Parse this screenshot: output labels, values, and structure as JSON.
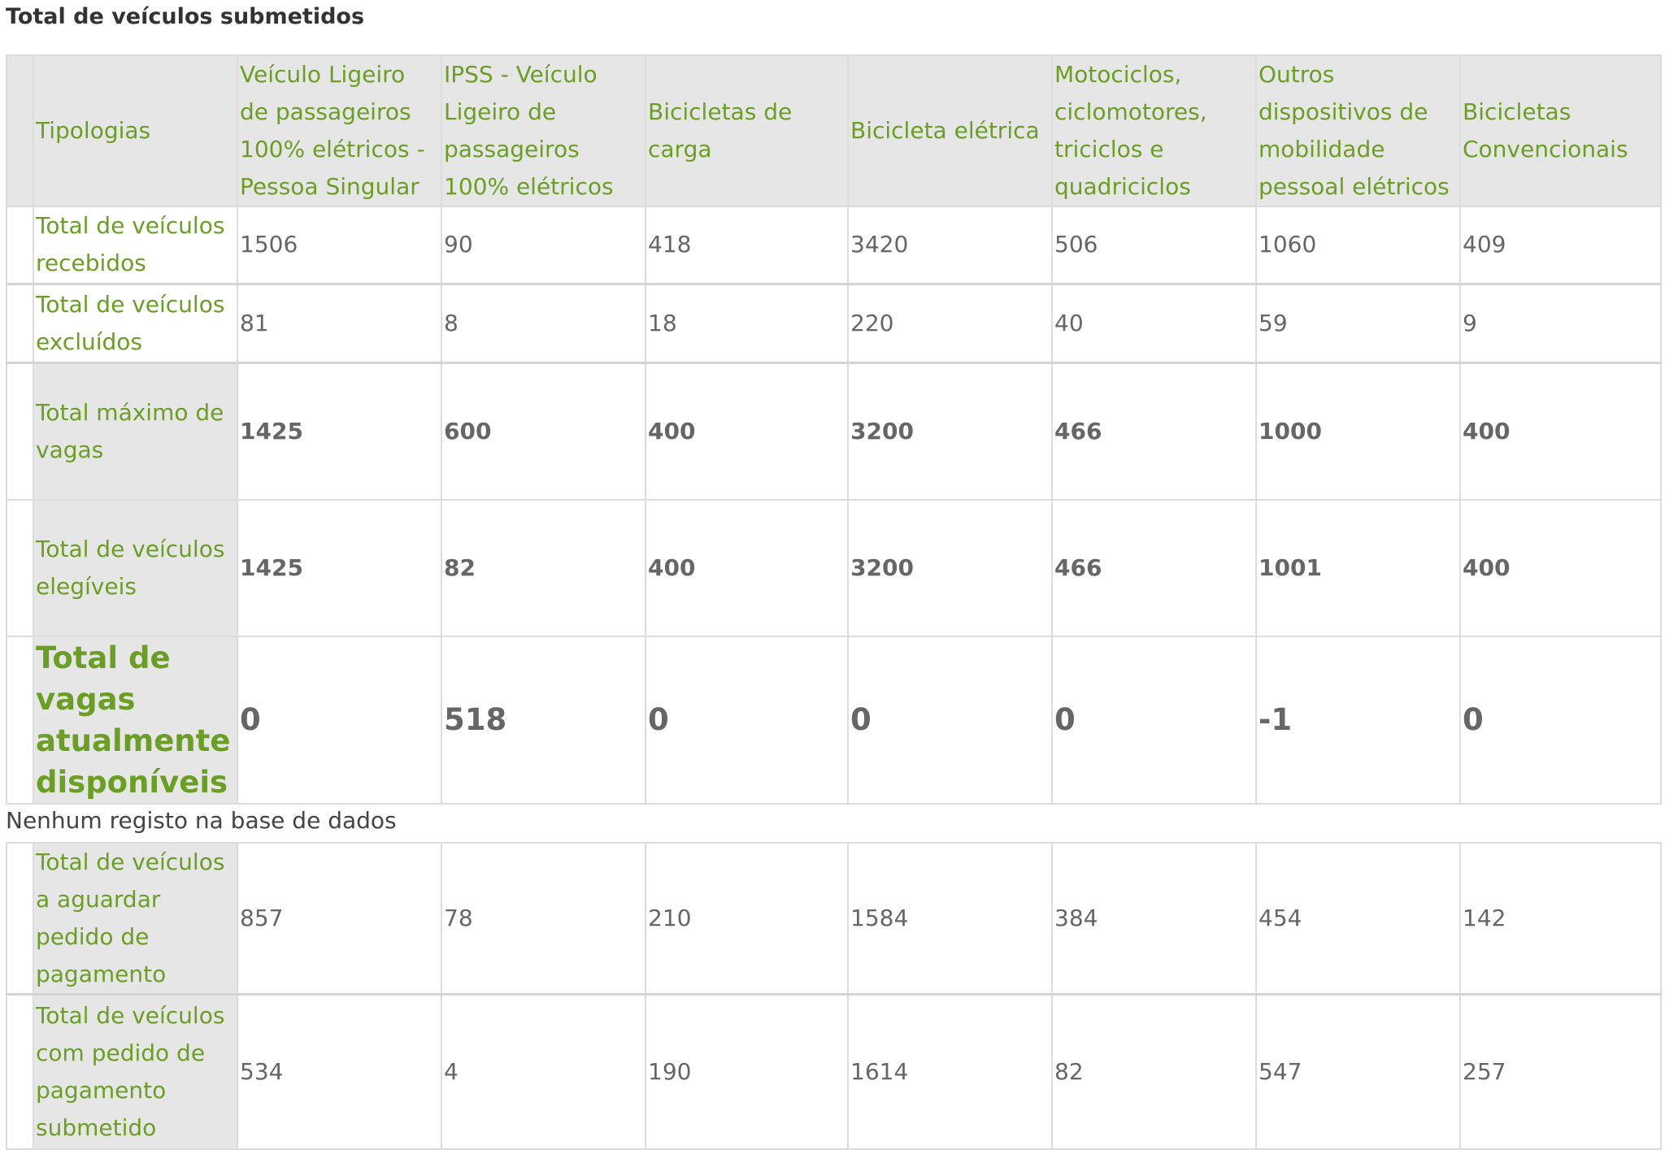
{
  "page": {
    "title": "Total de veículos submetidos"
  },
  "table": {
    "header": [
      "Tipologias",
      "Veículo Ligeiro de passageiros 100% elétricos - Pessoa Singular",
      "IPSS - Veículo Ligeiro de passageiros 100% elétricos",
      "Bicicletas de carga",
      "Bicicleta elétrica",
      "Motociclos, ciclomotores, triciclos e quadriciclos",
      "Outros dispositivos de mobilidade pessoal elétricos",
      "Bicicletas Convencionais"
    ],
    "rows": [
      {
        "label": "Total de veículos recebidos",
        "values": [
          "1506",
          "90",
          "418",
          "3420",
          "506",
          "1060",
          "409"
        ]
      },
      {
        "label": "Total de veículos excluídos",
        "values": [
          "81",
          "8",
          "18",
          "220",
          "40",
          "59",
          "9"
        ]
      },
      {
        "label": "Total máximo de vagas",
        "values": [
          "1425",
          "600",
          "400",
          "3200",
          "466",
          "1000",
          "400"
        ]
      },
      {
        "label": "Total de veículos elegíveis",
        "values": [
          "1425",
          "82",
          "400",
          "3200",
          "466",
          "1001",
          "400"
        ]
      },
      {
        "label": "Total de vagas atualmente disponíveis",
        "values": [
          "0",
          "518",
          "0",
          "0",
          "0",
          "-1",
          "0"
        ]
      }
    ]
  },
  "empty_message": "Nenhum registo na base de dados",
  "payment_table": {
    "rows": [
      {
        "label": "Total de veículos a aguardar pedido de pagamento",
        "values": [
          "857",
          "78",
          "210",
          "1584",
          "384",
          "454",
          "142"
        ]
      },
      {
        "label": "Total de veículos com pedido de pagamento submetido",
        "values": [
          "534",
          "4",
          "190",
          "1614",
          "82",
          "547",
          "257"
        ]
      }
    ]
  }
}
